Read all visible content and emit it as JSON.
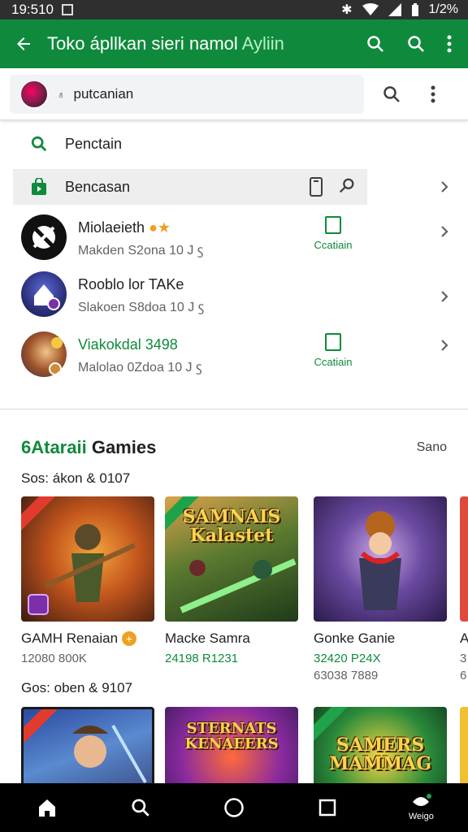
{
  "status_bar": {
    "time": "19:510",
    "battery": "1/2%"
  },
  "app_bar": {
    "title_main": "Toko ápllkan sieri namol ",
    "title_accent": "Ayliin"
  },
  "search": {
    "value": "putcanian"
  },
  "suggestions": [
    {
      "label": "Penctain"
    },
    {
      "label": "Bencasan"
    }
  ],
  "apps": [
    {
      "name": "Miolaeieth",
      "sub": "Makden S2ona 10 J ꚃ",
      "action": "Ccatiain"
    },
    {
      "name": "Rooblo lor TAKe",
      "sub": "Slakoen S8doa 10 J ꚃ"
    },
    {
      "name": "Viakokdal 3498",
      "sub": "Malolao 0Zdoa 10 J ꚃ",
      "action": "Ccatiain"
    }
  ],
  "games": {
    "title_part1": "6Ataraii",
    "title_part2": " Gamies",
    "see_more": "Sano",
    "subhead_1": "Sos: ákon & 0107",
    "subhead_2": "Gos: oben & 9107",
    "cards": [
      {
        "name": "GAMH Renaian",
        "meta": "12080 800K"
      },
      {
        "name": "Macke Samra",
        "meta": "24198 R1231",
        "art": "SAMNAIS Kalastet"
      },
      {
        "name": "Gonke Ganie",
        "meta": "32420 P24X",
        "meta2": "63038 7889"
      },
      {
        "name": "A",
        "meta": "3",
        "meta2": "6"
      }
    ],
    "row2_art": [
      {
        "art": ""
      },
      {
        "art": "STERNATS KENAEERS"
      },
      {
        "art": "SAMERS MAMMAG"
      }
    ]
  },
  "nav": {
    "label_last": "Weigo"
  },
  "colors": {
    "primary": "#0f8a3c",
    "status_bar": "#2f2f2f",
    "nav_bar": "#000000"
  }
}
